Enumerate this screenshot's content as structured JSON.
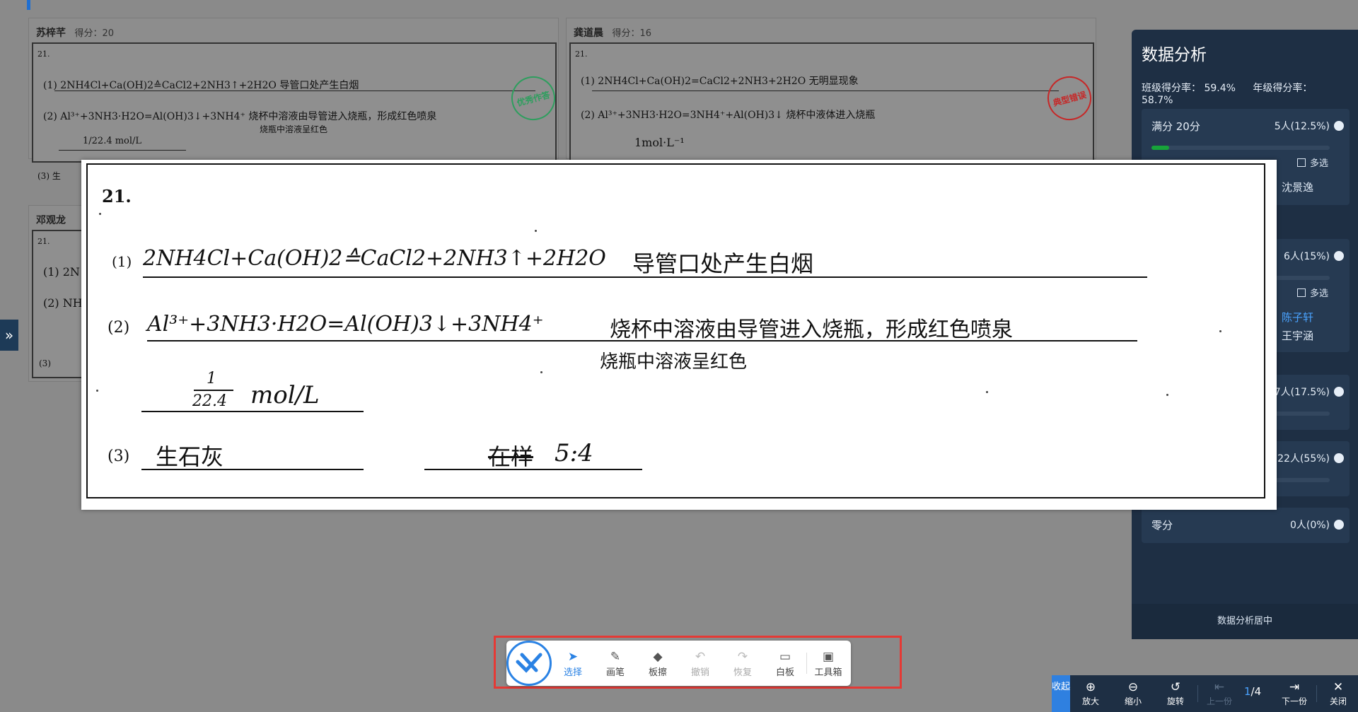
{
  "background": {
    "students": [
      {
        "name": "苏梓芊",
        "score_label": "得分：20",
        "q": "21.",
        "lines": [
          "(1) 2NH4Cl+Ca(OH)2≙CaCl2+2NH3↑+2H2O  导管口处产生白烟",
          "(2) Al³⁺+3NH3·H2O=Al(OH)3↓+3NH4⁺  烧杯中溶液由导管进入烧瓶，形成红色喷泉",
          "烧瓶中溶液呈红色",
          "1/22.4 mol/L",
          "(3) 生"
        ]
      },
      {
        "name": "龚道晨",
        "score_label": "得分：16",
        "q": "21.",
        "lines": [
          "(1) 2NH4Cl+Ca(OH)2=CaCl2+2NH3+2H2O  无明显现象",
          "(2) Al³⁺+3NH3·H2O=3NH4⁺+Al(OH)3↓  烧杯中液体进入烧瓶",
          "1mol·L⁻¹"
        ]
      },
      {
        "name": "邓观龙",
        "score_label": "",
        "q": "21.",
        "lines": [
          "(1) 2N",
          "(2) NH",
          "(3)"
        ]
      }
    ],
    "stamps": {
      "excellent": "优秀作答",
      "typical": "典型错误"
    }
  },
  "zoom_sheet": {
    "q_number": "21.",
    "parts": [
      {
        "label": "(1)",
        "answer": "2NH4Cl+Ca(OH)2≙CaCl2+2NH3↑+2H2O",
        "answer2": "导管口处产生白烟"
      },
      {
        "label": "(2)",
        "answer": "Al³⁺+3NH3·H2O=Al(OH)3↓+3NH4⁺",
        "answer2": "烧杯中溶液由导管进入烧瓶，形成红色喷泉",
        "answer3": "烧瓶中溶液呈红色",
        "answer4_num": "1",
        "answer4_den": "22.4",
        "answer4_unit": "mol/L"
      },
      {
        "label": "(3)",
        "answer": "生石灰",
        "answer2": "5:4",
        "strike": "在样"
      }
    ]
  },
  "panel": {
    "title": "数据分析",
    "class_rate": "班级得分率： 59.4%",
    "grade_rate": "年级得分率： 58.7%",
    "groups": [
      {
        "label": "满分 20分",
        "count": "5人(12.5%)",
        "fill": 0.1,
        "multi": "多选",
        "student": "沈景逸"
      },
      {
        "label": "",
        "count": "6人(15%)",
        "fill": 0.0,
        "multi": "多选",
        "students": [
          "陈子轩",
          "王宇涵"
        ]
      },
      {
        "label": "",
        "count": "7人(17.5%)",
        "fill": 0.0
      },
      {
        "label": "",
        "count": "22人(55%)",
        "fill": 0.0
      },
      {
        "label": "零分",
        "count": "0人(0%)",
        "fill": 0.0
      }
    ],
    "footer": "数据分析居中"
  },
  "toolbar": {
    "items": [
      {
        "label": "选择",
        "icon": "cursor-icon",
        "glyph": "➤",
        "state": "active"
      },
      {
        "label": "画笔",
        "icon": "pen-icon",
        "glyph": "✎",
        "state": "normal"
      },
      {
        "label": "板擦",
        "icon": "eraser-icon",
        "glyph": "◆",
        "state": "normal"
      },
      {
        "label": "撤销",
        "icon": "undo-icon",
        "glyph": "↶",
        "state": "disabled"
      },
      {
        "label": "恢复",
        "icon": "redo-icon",
        "glyph": "↷",
        "state": "disabled"
      },
      {
        "label": "白板",
        "icon": "whiteboard-icon",
        "glyph": "▭",
        "state": "normal"
      },
      {
        "label": "工具箱",
        "icon": "toolbox-icon",
        "glyph": "▣",
        "state": "normal"
      }
    ]
  },
  "navbar": {
    "collapse": "收起",
    "zoom_in": "放大",
    "zoom_out": "缩小",
    "rotate": "旋转",
    "prev": "上一份",
    "page_current": "1",
    "page_total": "/4",
    "next": "下一份",
    "close": "关闭"
  },
  "colors": {
    "accent": "#2a82e4",
    "panel_bg": "#1e2f44",
    "highlight": "#e53935",
    "bar_fill": "#17a43a"
  }
}
